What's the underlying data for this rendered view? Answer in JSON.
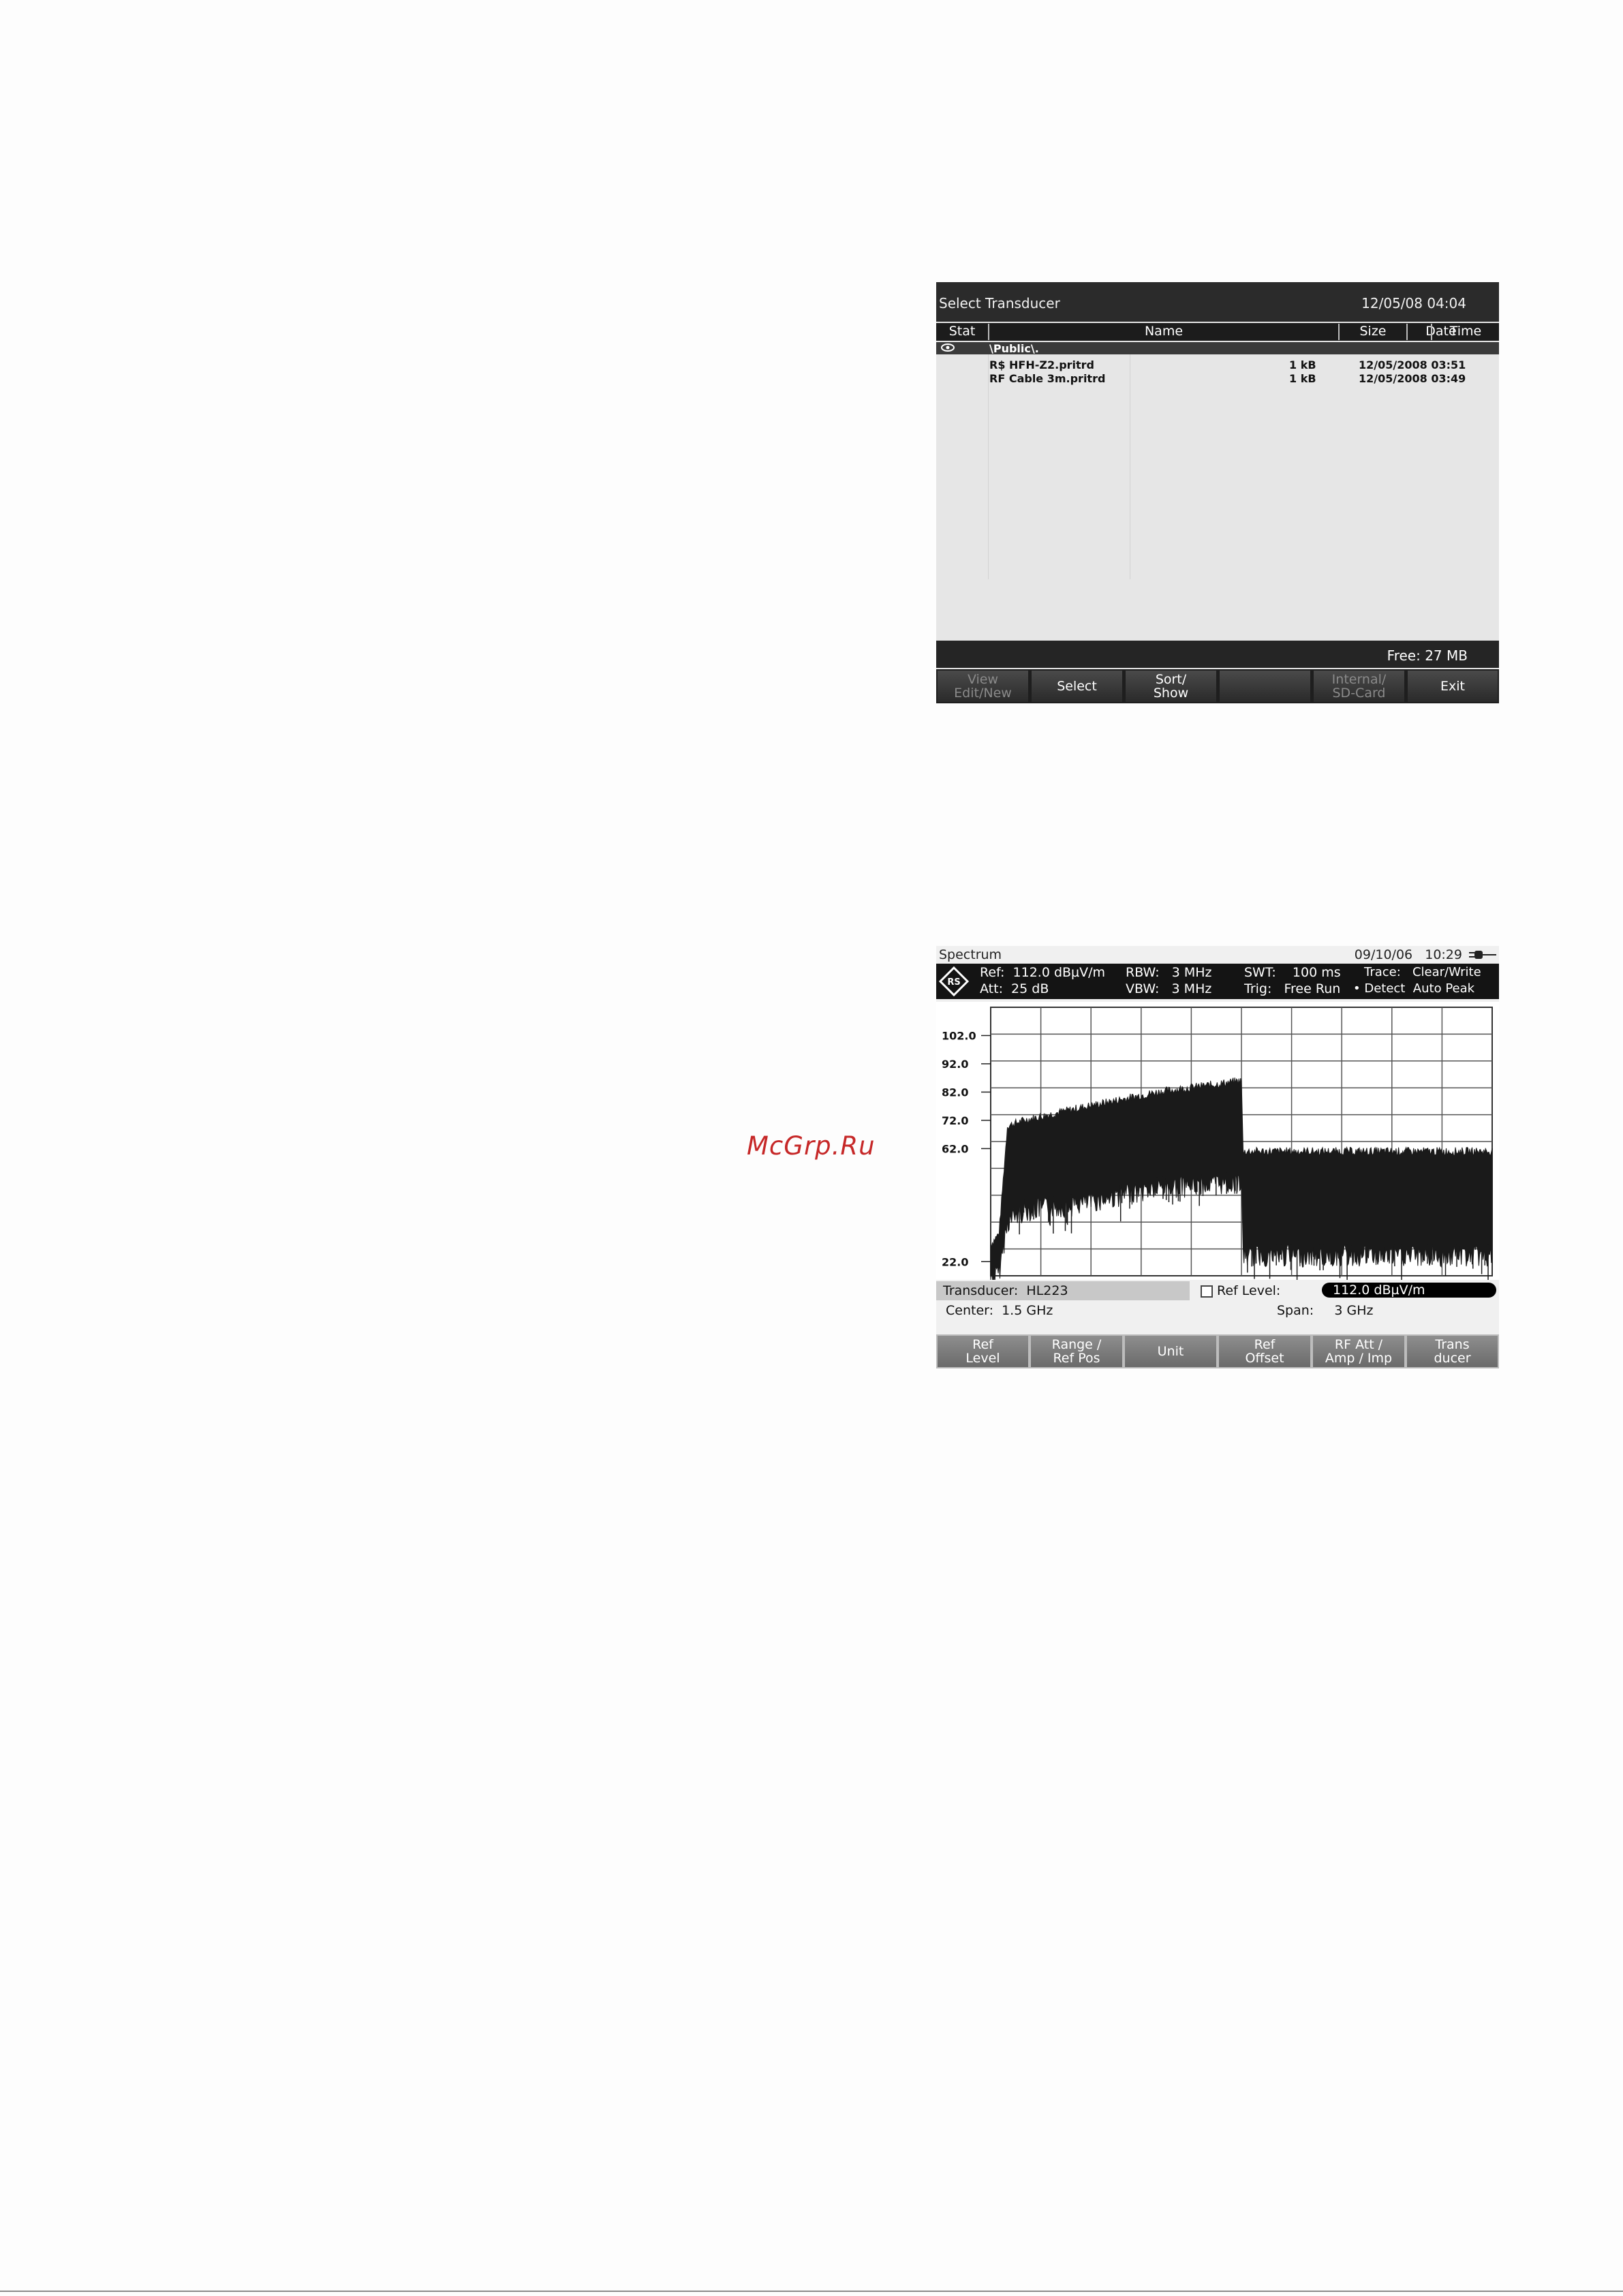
{
  "transducer_select": {
    "title": "Select Transducer",
    "datetime": "12/05/08 04:04",
    "columns": [
      "Stat",
      "Name",
      "Size",
      "Date",
      "Time"
    ],
    "path": "\\Public\\.",
    "files": [
      {
        "name": "R$ HFH-Z2.pritrd",
        "size": "1 kB",
        "datetime": "12/05/2008 03:51"
      },
      {
        "name": "RF Cable 3m.pritrd",
        "size": "1 kB",
        "datetime": "12/05/2008 03:49"
      }
    ],
    "free_space": "Free: 27 MB",
    "softkeys": [
      {
        "label": "View\nEdit/New",
        "enabled": false
      },
      {
        "label": "Select",
        "enabled": true
      },
      {
        "label": "Sort/\nShow",
        "enabled": true
      },
      {
        "label": "",
        "enabled": true
      },
      {
        "label": "Internal/\nSD-Card",
        "enabled": false
      },
      {
        "label": "Exit",
        "enabled": true
      }
    ]
  },
  "spectrum": {
    "mode": "Spectrum",
    "datetime": "09/10/06   10:29",
    "battery_icon": "battery-plug-icon",
    "logo_icon": "rs-logo-icon",
    "ref": "Ref:  112.0 dBµV/m",
    "att": "Att:  25 dB",
    "rbw": "RBW:   3 MHz",
    "vbw": "VBW:   3 MHz",
    "swt": "SWT:    100 ms",
    "trig": "Trig:   Free Run",
    "trace": "Trace:   Clear/Write",
    "detect": "• Detect  Auto Peak",
    "transducer_label": "Transducer:  HL223",
    "ref_level_label": "Ref Level:",
    "ref_level_value": "112.0 dBµV/m",
    "center": "Center:  1.5 GHz",
    "span": "Span:     3 GHz",
    "softkeys": [
      "Ref\nLevel",
      "Range /\nRef Pos",
      "Unit",
      "Ref\nOffset",
      "RF Att /\nAmp / Imp",
      "Trans\nducer"
    ]
  },
  "chart_data": {
    "type": "area",
    "title": "",
    "xlabel": "",
    "ylabel": "",
    "y_ticks": [
      102.0,
      92.0,
      82.0,
      72.0,
      62.0,
      22.0
    ],
    "y_tick_labels": [
      "102.0",
      "92.0",
      "82.0",
      "72.0",
      "62.0",
      "22.0"
    ],
    "ylim": [
      17,
      112
    ],
    "xlim": [
      0,
      3
    ],
    "grid": true,
    "series": [
      {
        "x": [
          0,
          0.05,
          0.1,
          0.2,
          0.5,
          1.0,
          1.5,
          1.51,
          2.0,
          2.5,
          3.0
        ],
        "y_max": [
          28,
          32,
          70,
          72,
          76,
          82,
          86,
          61,
          61,
          61,
          61
        ],
        "y_min": [
          20,
          22,
          40,
          44,
          46,
          52,
          54,
          28,
          28,
          28,
          28
        ]
      }
    ]
  },
  "watermark": "McGrp.Ru"
}
